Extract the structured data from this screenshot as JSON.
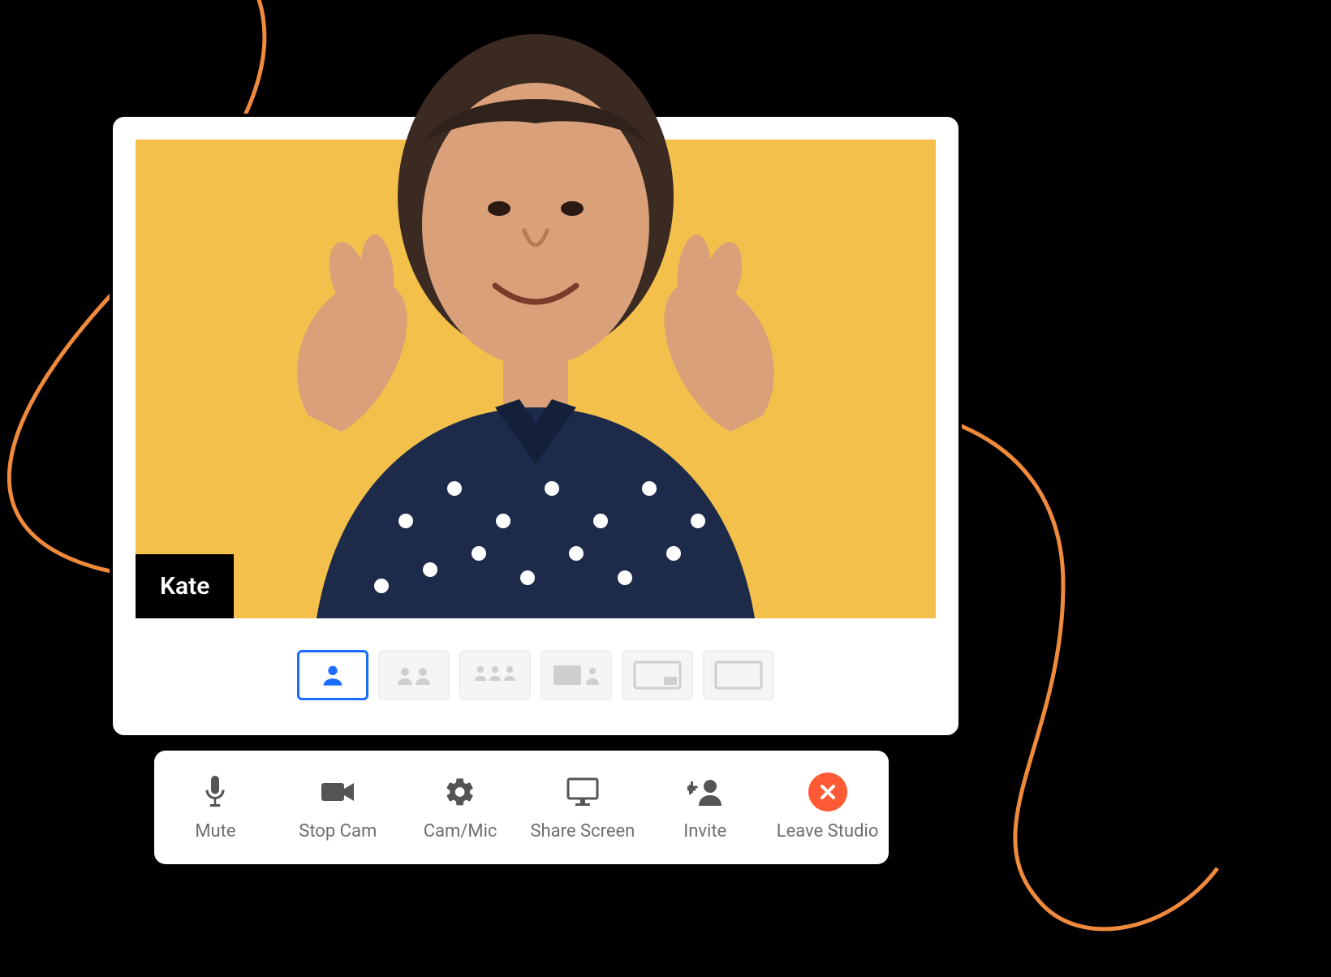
{
  "participant": {
    "name": "Kate"
  },
  "layouts": {
    "active_index": 0,
    "items": [
      {
        "id": "solo"
      },
      {
        "id": "two-up"
      },
      {
        "id": "grid-3"
      },
      {
        "id": "speaker-side"
      },
      {
        "id": "pip"
      },
      {
        "id": "blank"
      }
    ]
  },
  "toolbar": {
    "mute_label": "Mute",
    "stopcam_label": "Stop Cam",
    "cammic_label": "Cam/Mic",
    "share_label": "Share Screen",
    "invite_label": "Invite",
    "leave_label": "Leave Studio"
  },
  "colors": {
    "video_bg": "#f3c14b",
    "accent": "#1a6dff",
    "leave": "#ff5a36",
    "swoosh": "#f08a3c"
  }
}
